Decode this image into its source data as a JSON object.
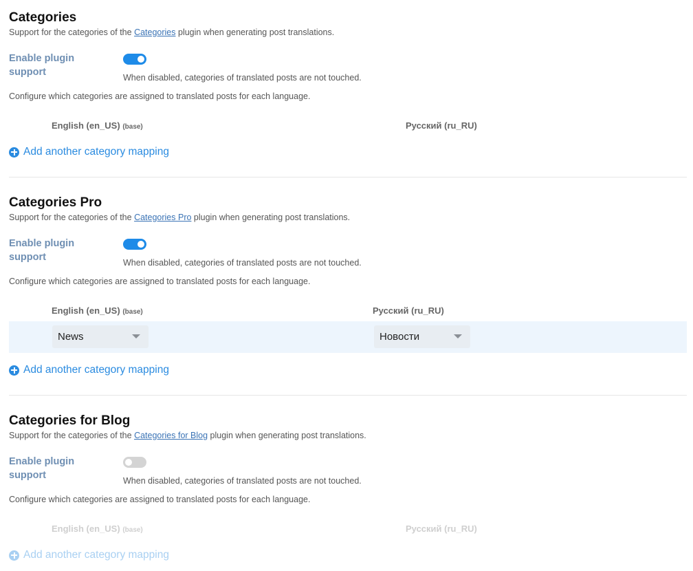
{
  "sections": [
    {
      "title": "Categories",
      "desc_before": "Support for the categories of the ",
      "desc_link": "Categories",
      "desc_after": " plugin when generating post translations.",
      "enable_label": "Enable plugin support",
      "enabled": true,
      "toggle_help": "When disabled, categories of translated posts are not touched.",
      "config_help": "Configure which categories are assigned to translated posts for each language.",
      "col_base_lang": "English (en_US)",
      "col_base_tag": "(base)",
      "col_target_lang": "Русский (ru_RU)",
      "add_mapping": "Add another category mapping"
    },
    {
      "title": "Categories Pro",
      "desc_before": "Support for the categories of the ",
      "desc_link": "Categories Pro",
      "desc_after": " plugin when generating post translations.",
      "enable_label": "Enable plugin support",
      "enabled": true,
      "toggle_help": "When disabled, categories of translated posts are not touched.",
      "config_help": "Configure which categories are assigned to translated posts for each language.",
      "col_base_lang": "English (en_US)",
      "col_base_tag": "(base)",
      "col_target_lang": "Русский (ru_RU)",
      "mapping": {
        "base_value": "News",
        "target_value": "Новости"
      },
      "add_mapping": "Add another category mapping"
    },
    {
      "title": "Categories for Blog",
      "desc_before": "Support for the categories of the ",
      "desc_link": "Categories for Blog",
      "desc_after": " plugin when generating post translations.",
      "enable_label": "Enable plugin support",
      "enabled": false,
      "toggle_help": "When disabled, categories of translated posts are not touched.",
      "config_help": "Configure which categories are assigned to translated posts for each language.",
      "col_base_lang": "English (en_US)",
      "col_base_tag": "(base)",
      "col_target_lang": "Русский (ru_RU)",
      "add_mapping": "Add another category mapping"
    }
  ],
  "colors": {
    "accent": "#1e8be8",
    "link": "#3a73b5",
    "label": "#6f8fb3",
    "row_highlight": "#edf5fd"
  },
  "icons": {
    "add": "plus-circle-icon",
    "dropdown": "chevron-down-icon"
  }
}
